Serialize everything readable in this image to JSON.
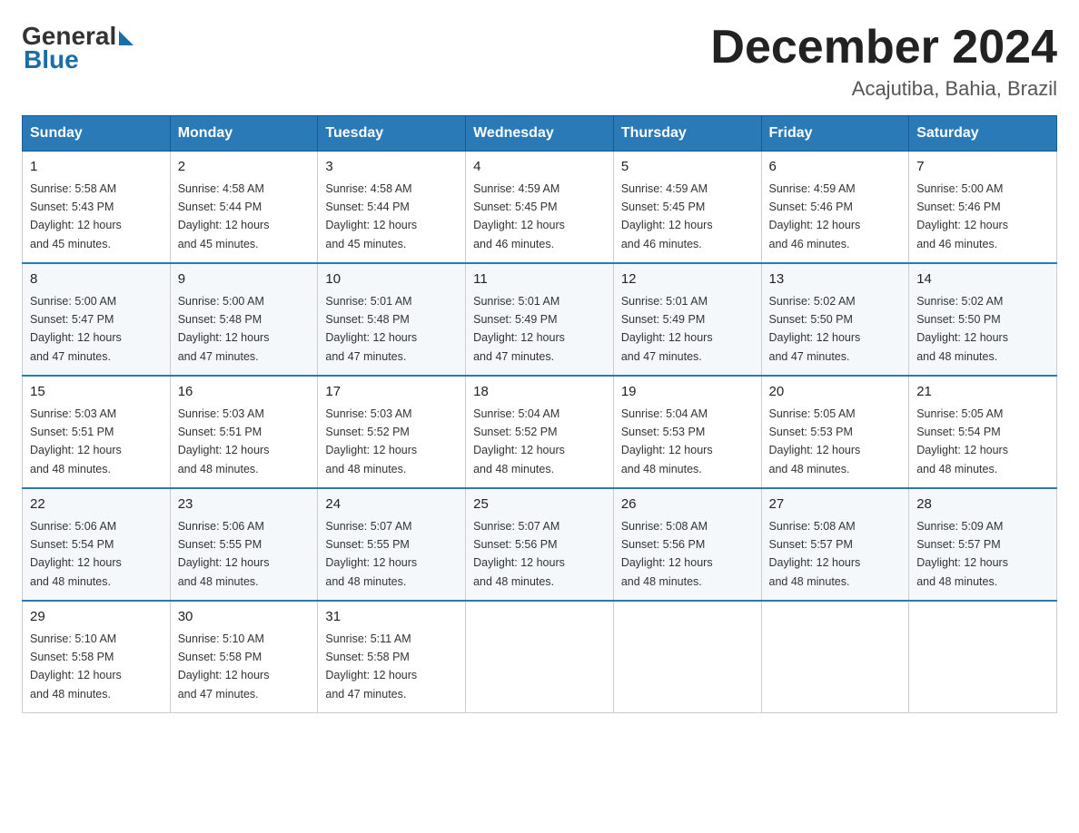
{
  "header": {
    "logo_general": "General",
    "logo_blue": "Blue",
    "month_title": "December 2024",
    "location": "Acajutiba, Bahia, Brazil"
  },
  "days_of_week": [
    "Sunday",
    "Monday",
    "Tuesday",
    "Wednesday",
    "Thursday",
    "Friday",
    "Saturday"
  ],
  "weeks": [
    [
      {
        "day": "1",
        "sunrise": "5:58 AM",
        "sunset": "5:43 PM",
        "daylight": "12 hours and 45 minutes."
      },
      {
        "day": "2",
        "sunrise": "4:58 AM",
        "sunset": "5:44 PM",
        "daylight": "12 hours and 45 minutes."
      },
      {
        "day": "3",
        "sunrise": "4:58 AM",
        "sunset": "5:44 PM",
        "daylight": "12 hours and 45 minutes."
      },
      {
        "day": "4",
        "sunrise": "4:59 AM",
        "sunset": "5:45 PM",
        "daylight": "12 hours and 46 minutes."
      },
      {
        "day": "5",
        "sunrise": "4:59 AM",
        "sunset": "5:45 PM",
        "daylight": "12 hours and 46 minutes."
      },
      {
        "day": "6",
        "sunrise": "4:59 AM",
        "sunset": "5:46 PM",
        "daylight": "12 hours and 46 minutes."
      },
      {
        "day": "7",
        "sunrise": "5:00 AM",
        "sunset": "5:46 PM",
        "daylight": "12 hours and 46 minutes."
      }
    ],
    [
      {
        "day": "8",
        "sunrise": "5:00 AM",
        "sunset": "5:47 PM",
        "daylight": "12 hours and 47 minutes."
      },
      {
        "day": "9",
        "sunrise": "5:00 AM",
        "sunset": "5:48 PM",
        "daylight": "12 hours and 47 minutes."
      },
      {
        "day": "10",
        "sunrise": "5:01 AM",
        "sunset": "5:48 PM",
        "daylight": "12 hours and 47 minutes."
      },
      {
        "day": "11",
        "sunrise": "5:01 AM",
        "sunset": "5:49 PM",
        "daylight": "12 hours and 47 minutes."
      },
      {
        "day": "12",
        "sunrise": "5:01 AM",
        "sunset": "5:49 PM",
        "daylight": "12 hours and 47 minutes."
      },
      {
        "day": "13",
        "sunrise": "5:02 AM",
        "sunset": "5:50 PM",
        "daylight": "12 hours and 47 minutes."
      },
      {
        "day": "14",
        "sunrise": "5:02 AM",
        "sunset": "5:50 PM",
        "daylight": "12 hours and 48 minutes."
      }
    ],
    [
      {
        "day": "15",
        "sunrise": "5:03 AM",
        "sunset": "5:51 PM",
        "daylight": "12 hours and 48 minutes."
      },
      {
        "day": "16",
        "sunrise": "5:03 AM",
        "sunset": "5:51 PM",
        "daylight": "12 hours and 48 minutes."
      },
      {
        "day": "17",
        "sunrise": "5:03 AM",
        "sunset": "5:52 PM",
        "daylight": "12 hours and 48 minutes."
      },
      {
        "day": "18",
        "sunrise": "5:04 AM",
        "sunset": "5:52 PM",
        "daylight": "12 hours and 48 minutes."
      },
      {
        "day": "19",
        "sunrise": "5:04 AM",
        "sunset": "5:53 PM",
        "daylight": "12 hours and 48 minutes."
      },
      {
        "day": "20",
        "sunrise": "5:05 AM",
        "sunset": "5:53 PM",
        "daylight": "12 hours and 48 minutes."
      },
      {
        "day": "21",
        "sunrise": "5:05 AM",
        "sunset": "5:54 PM",
        "daylight": "12 hours and 48 minutes."
      }
    ],
    [
      {
        "day": "22",
        "sunrise": "5:06 AM",
        "sunset": "5:54 PM",
        "daylight": "12 hours and 48 minutes."
      },
      {
        "day": "23",
        "sunrise": "5:06 AM",
        "sunset": "5:55 PM",
        "daylight": "12 hours and 48 minutes."
      },
      {
        "day": "24",
        "sunrise": "5:07 AM",
        "sunset": "5:55 PM",
        "daylight": "12 hours and 48 minutes."
      },
      {
        "day": "25",
        "sunrise": "5:07 AM",
        "sunset": "5:56 PM",
        "daylight": "12 hours and 48 minutes."
      },
      {
        "day": "26",
        "sunrise": "5:08 AM",
        "sunset": "5:56 PM",
        "daylight": "12 hours and 48 minutes."
      },
      {
        "day": "27",
        "sunrise": "5:08 AM",
        "sunset": "5:57 PM",
        "daylight": "12 hours and 48 minutes."
      },
      {
        "day": "28",
        "sunrise": "5:09 AM",
        "sunset": "5:57 PM",
        "daylight": "12 hours and 48 minutes."
      }
    ],
    [
      {
        "day": "29",
        "sunrise": "5:10 AM",
        "sunset": "5:58 PM",
        "daylight": "12 hours and 48 minutes."
      },
      {
        "day": "30",
        "sunrise": "5:10 AM",
        "sunset": "5:58 PM",
        "daylight": "12 hours and 47 minutes."
      },
      {
        "day": "31",
        "sunrise": "5:11 AM",
        "sunset": "5:58 PM",
        "daylight": "12 hours and 47 minutes."
      },
      null,
      null,
      null,
      null
    ]
  ],
  "labels": {
    "sunrise": "Sunrise:",
    "sunset": "Sunset:",
    "daylight": "Daylight:"
  }
}
